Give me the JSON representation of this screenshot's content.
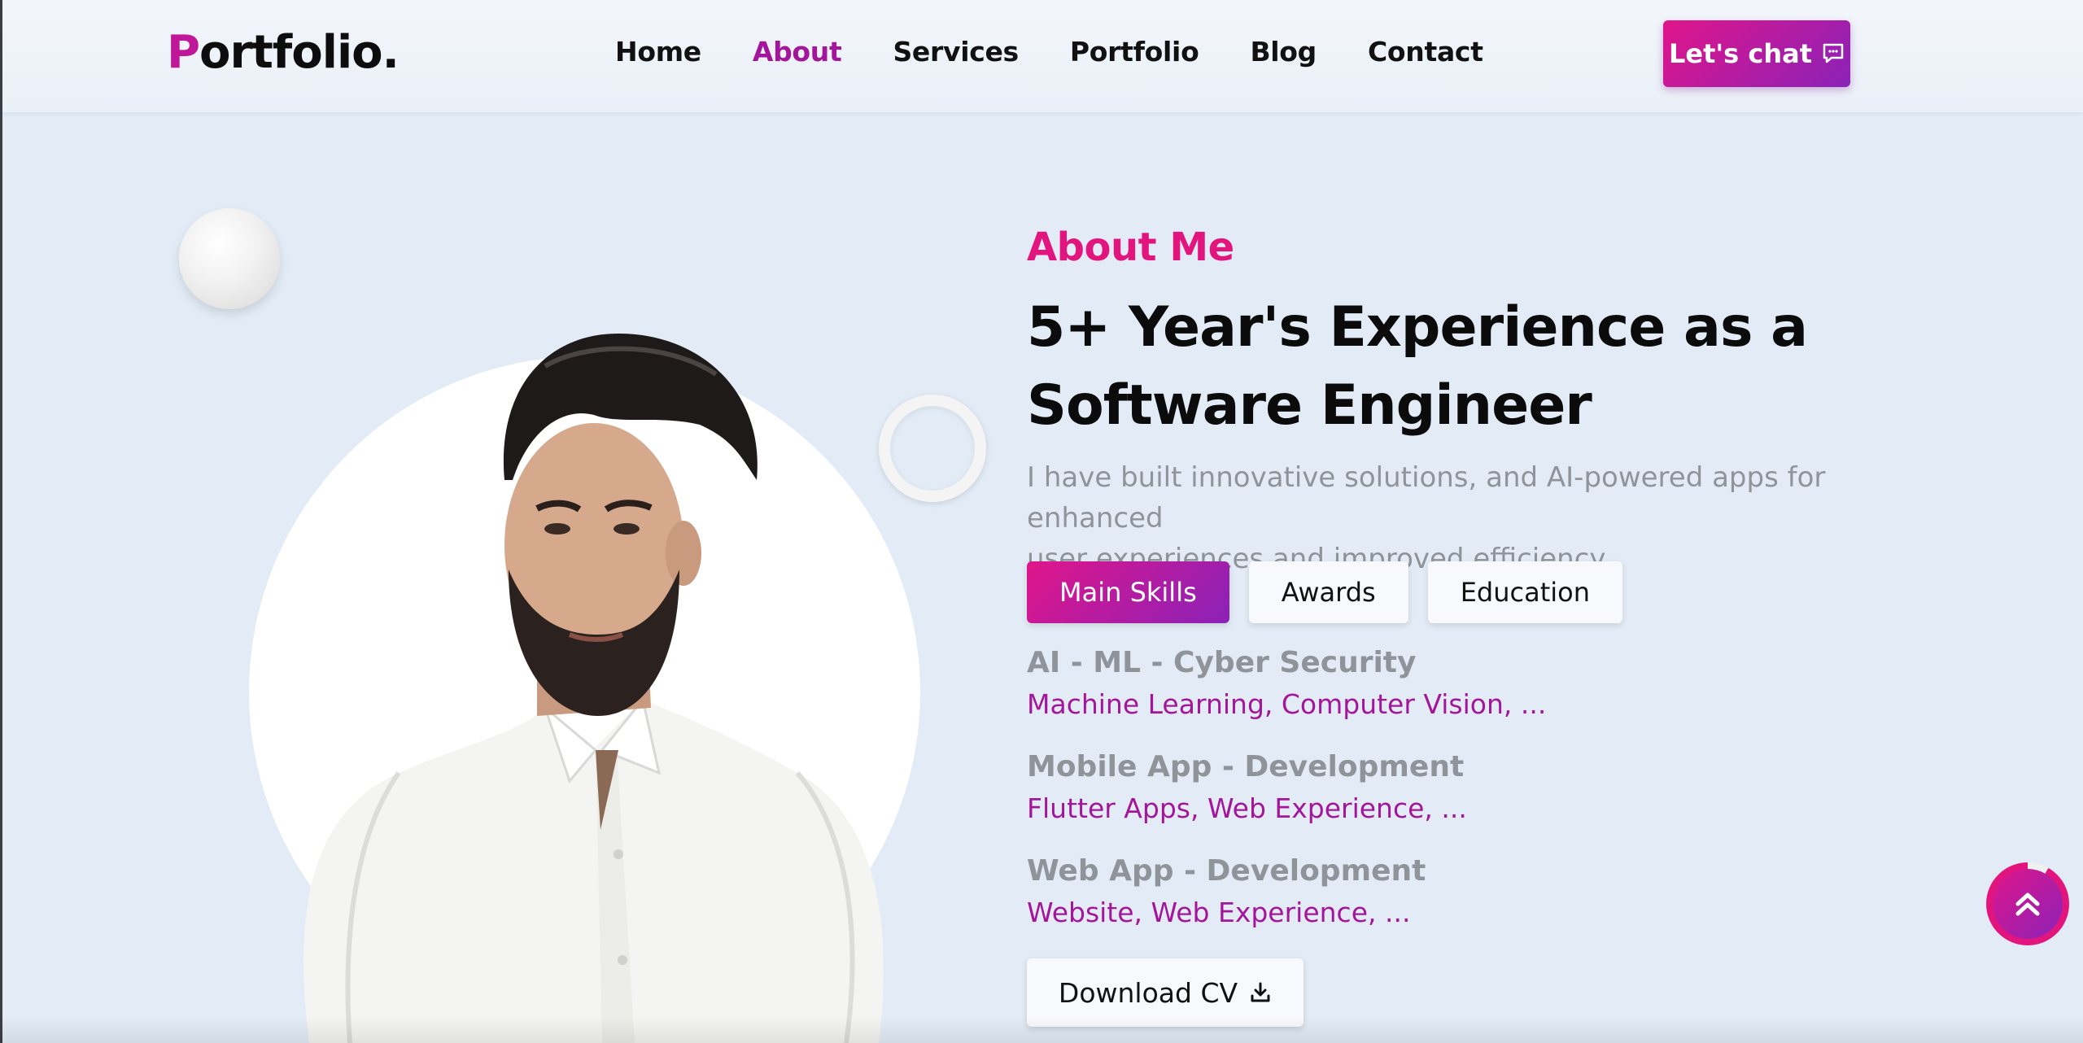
{
  "header": {
    "logo_initial": "P",
    "logo_rest": "ortfolio.",
    "nav": [
      {
        "label": "Home",
        "active": false
      },
      {
        "label": "About",
        "active": true
      },
      {
        "label": "Services",
        "active": false
      },
      {
        "label": "Portfolio",
        "active": false
      },
      {
        "label": "Blog",
        "active": false
      },
      {
        "label": "Contact",
        "active": false
      }
    ],
    "chat_label": "Let's chat",
    "chat_icon": "chat-bubble-icon"
  },
  "about": {
    "label": "About Me",
    "headline_line1": "5+ Year's Experience as a",
    "headline_line2": "Software Engineer",
    "intro_line1": "I have built innovative solutions, and AI-powered apps for enhanced",
    "intro_line2": "user experiences and improved efficiency.",
    "tabs": [
      {
        "label": "Main Skills",
        "active": true
      },
      {
        "label": "Awards",
        "active": false
      },
      {
        "label": "Education",
        "active": false
      }
    ],
    "skills": [
      {
        "title": "AI - ML - Cyber Security",
        "sub": "Machine Learning, Computer Vision, ..."
      },
      {
        "title": "Mobile App - Development",
        "sub": "Flutter Apps, Web Experience, ..."
      },
      {
        "title": "Web App - Development",
        "sub": "Website, Web Experience, ..."
      }
    ],
    "cv_label": "Download CV",
    "cv_icon": "download-icon"
  },
  "scroll_top_icon": "double-chevron-up-icon",
  "colors": {
    "accent_pink": "#e2157f",
    "accent_purple": "#8a22b8",
    "nav_active": "#a3169b",
    "background": "#e3ecf6"
  }
}
